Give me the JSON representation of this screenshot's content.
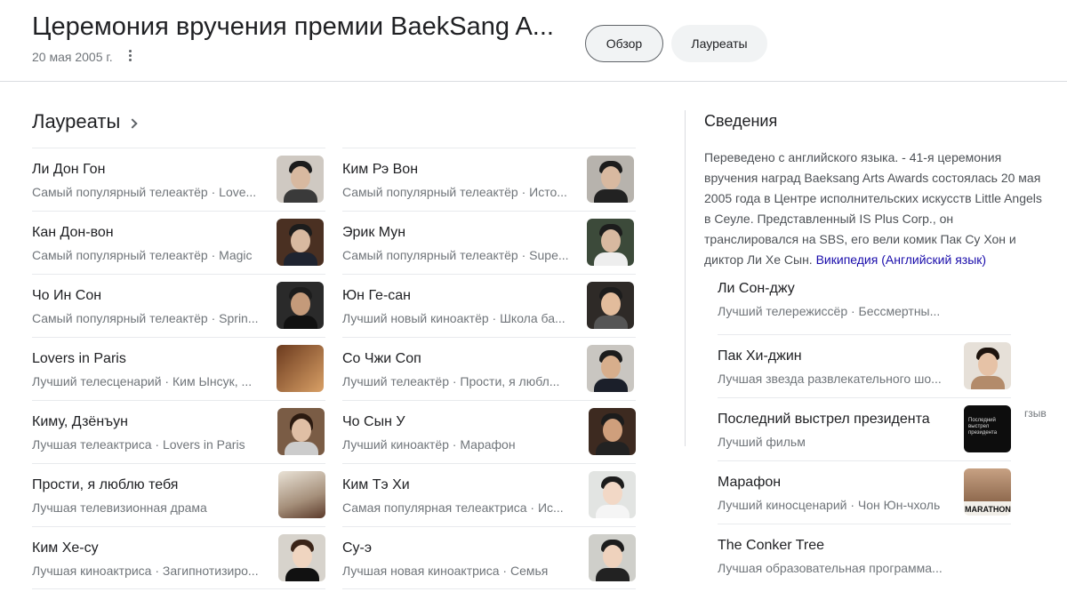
{
  "header": {
    "title": "Церемония вручения премии BaekSang A...",
    "date": "20 мая 2005 г.",
    "tabs": [
      {
        "label": "Обзор",
        "selected": true
      },
      {
        "label": "Лауреаты",
        "selected": false
      }
    ]
  },
  "winners": {
    "title": "Лауреаты",
    "left": [
      {
        "name": "Ли Дон Гон",
        "desc": "Самый популярный телеактёр · Love..."
      },
      {
        "name": "Кан Дон-вон",
        "desc": "Самый популярный телеактёр · Magic"
      },
      {
        "name": "Чо Ин Сон",
        "desc": "Самый популярный телеактёр · Sprin..."
      },
      {
        "name": "Lovers in Paris",
        "desc": "Лучший телесценарий · Ким Ынсук, ..."
      },
      {
        "name": "Киму, Дзёнъун",
        "desc": "Лучшая телеактриса · Lovers in Paris"
      },
      {
        "name": "Прости, я люблю тебя",
        "desc": "Лучшая телевизионная драма"
      },
      {
        "name": "Ким Хе-су",
        "desc": "Лучшая киноактриса · Загипнотизиро..."
      }
    ],
    "middle": [
      {
        "name": "Ким Рэ Вон",
        "desc": "Самый популярный телеактёр · Исто..."
      },
      {
        "name": "Эрик Мун",
        "desc": "Самый популярный телеактёр · Supe..."
      },
      {
        "name": "Юн Ге-сан",
        "desc": "Лучший новый киноактёр · Школа ба..."
      },
      {
        "name": "Со Чжи Соп",
        "desc": "Лучший телеактёр · Прости, я любл..."
      },
      {
        "name": "Чо Сын У",
        "desc": "Лучший киноактёр · Марафон"
      },
      {
        "name": "Ким Тэ Хи",
        "desc": "Самая популярная телеактриса · Ис..."
      },
      {
        "name": "Су-э",
        "desc": "Лучшая новая киноактриса · Семья"
      }
    ],
    "right": [
      {
        "name": "Ли Сон-джу",
        "desc": "Лучший телережиссёр · Бессмертны..."
      },
      {
        "name": "Пак Хи-джин",
        "desc": "Лучшая звезда развлекательного шо..."
      },
      {
        "name": "Последний выстрел президента",
        "desc": "Лучший фильм"
      },
      {
        "name": "Марафон",
        "desc": "Лучший киносценарий · Чон Юн-чхоль"
      },
      {
        "name": "The Conker Tree",
        "desc": "Лучшая образовательная программа..."
      }
    ]
  },
  "info": {
    "title": "Сведения",
    "text": "Переведено с английского языка. - 41-я церемония вручения наград Baeksang Arts Awards состоялась 20 мая 2005 года в Центре исполнительских искусств Little Angels в Сеуле. Представленный IS Plus Corp., он транслировался на SBS, его вели комик Пак Су Хон и диктор Ли Хе Сын. ",
    "link": "Википедия (Английский язык)"
  },
  "stray_text": "гзыв",
  "poster": {
    "lines": [
      "Последний",
      "выстрел",
      "президента"
    ],
    "marathon": "MARATHON"
  },
  "colors": {
    "text": "#202124",
    "secondary": "#70757a",
    "link": "#1a0dab",
    "divider": "#e8eaed",
    "chip_bg": "#f1f3f4"
  }
}
